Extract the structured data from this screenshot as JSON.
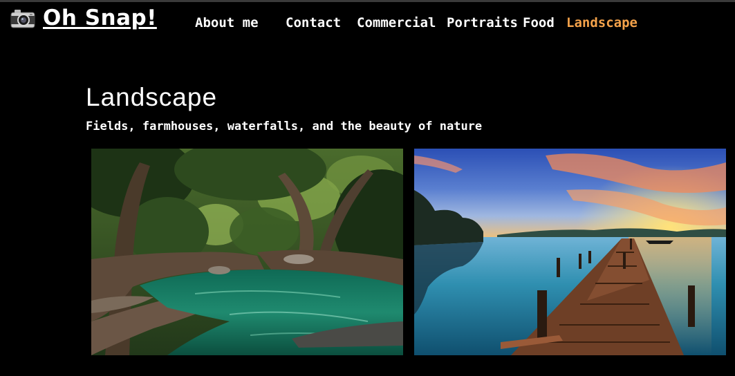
{
  "site": {
    "brand_name": "Oh Snap!",
    "brand_icon": "camera-icon"
  },
  "nav": {
    "items": [
      {
        "label": "About me"
      },
      {
        "label": "Contact"
      },
      {
        "label": "Commercial"
      },
      {
        "label": "Portraits"
      },
      {
        "label": "Food"
      },
      {
        "label": "Landscape"
      }
    ],
    "active_item": "Landscape",
    "active_color": "#f4a24a"
  },
  "main": {
    "title": "Landscape",
    "subtitle": "Fields, farmhouses, waterfalls, and the beauty of nature"
  },
  "gallery": {
    "photos": [
      {
        "subject": "forest river",
        "name": "landscape-photo-river"
      },
      {
        "subject": "lake pier at sunset",
        "name": "landscape-photo-lake-pier"
      }
    ]
  },
  "colors": {
    "background": "#000000",
    "text": "#ffffff",
    "accent": "#f4a24a"
  }
}
